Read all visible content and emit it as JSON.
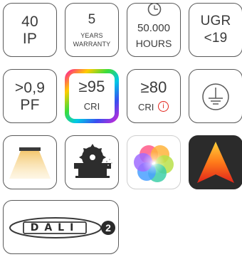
{
  "tiles": {
    "ip": {
      "line1": "40",
      "line2": "IP"
    },
    "warranty": {
      "line1": "5",
      "line2": "YEARS",
      "line3": "WARRANTY"
    },
    "hours": {
      "line1": "50.000",
      "line2": "HOURS",
      "icon": "clock-icon"
    },
    "ugr": {
      "line1": "UGR",
      "line2": "<19"
    },
    "pf": {
      "line1": ">0,9",
      "line2": "PF"
    },
    "cri95": {
      "line1": "≥95",
      "line2": "CRI",
      "border": "rainbow"
    },
    "cri80": {
      "line1": "≥80",
      "line2": "CRI",
      "warning": "i",
      "warning_color": "#e2231a"
    },
    "ground": {
      "icon": "protective-earth-icon"
    },
    "beam": {
      "icon": "downlight-beam-icon"
    },
    "saw": {
      "icon": "circular-saw-icon"
    },
    "color": {
      "icon": "color-wheel-icon"
    },
    "app": {
      "icon": "app-logo-icon",
      "colors": [
        "#ffd23a",
        "#ff7a1a",
        "#e0241b"
      ]
    },
    "dali": {
      "label": "DALI",
      "version": "2"
    }
  }
}
